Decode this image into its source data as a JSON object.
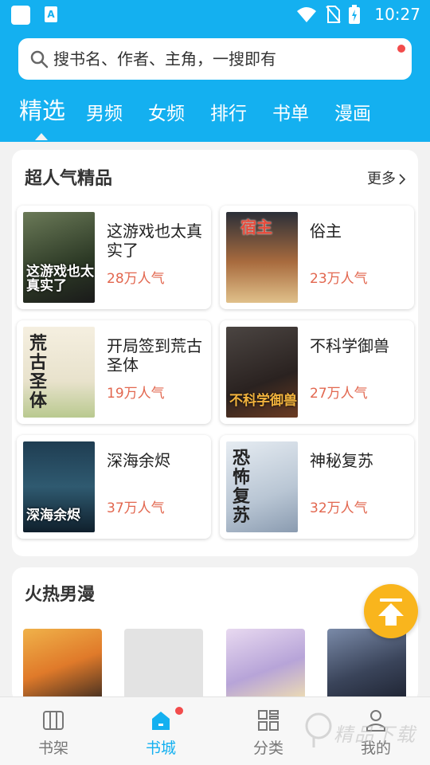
{
  "status_bar": {
    "time": "10:27",
    "notif_icon_letter": "A"
  },
  "search": {
    "placeholder": "搜书名、作者、主角，一搜即有"
  },
  "tabs": [
    {
      "label": "精选",
      "active": true
    },
    {
      "label": "男频"
    },
    {
      "label": "女频"
    },
    {
      "label": "排行"
    },
    {
      "label": "书单"
    },
    {
      "label": "漫画"
    }
  ],
  "section_popular": {
    "title": "超人气精品",
    "more_label": "更多",
    "books": [
      {
        "title": "这游戏也太真实了",
        "popularity": "28万人气",
        "cover_text": "这游戏也太真实了",
        "cover_color": "#4a5a3c"
      },
      {
        "title": "俗主",
        "popularity": "23万人气",
        "cover_text": "宿主",
        "cover_color": "#a86b3e"
      },
      {
        "title": "开局签到荒古圣体",
        "popularity": "19万人气",
        "cover_text": "荒古圣体",
        "cover_color": "#f2ead8"
      },
      {
        "title": "不科学御兽",
        "popularity": "27万人气",
        "cover_text": "不科学御兽",
        "cover_color": "#3a2f2c"
      },
      {
        "title": "深海余烬",
        "popularity": "37万人气",
        "cover_text": "深海余烬",
        "cover_color": "#27465a"
      },
      {
        "title": "神秘复苏",
        "popularity": "32万人气",
        "cover_text": "恐怖复苏",
        "cover_color": "#c9d3df"
      }
    ]
  },
  "section_comics": {
    "title": "火热男漫",
    "comics": [
      {
        "color": "#e59a3b"
      },
      {
        "color": "#e3e3e3"
      },
      {
        "color": "#c7b7dd"
      },
      {
        "color": "#4a556a"
      }
    ]
  },
  "bottom_nav": [
    {
      "label": "书架",
      "icon": "bookshelf-icon"
    },
    {
      "label": "书城",
      "icon": "bookstore-icon",
      "active": true
    },
    {
      "label": "分类",
      "icon": "category-icon"
    },
    {
      "label": "我的",
      "icon": "profile-icon"
    }
  ],
  "watermark": {
    "text": "精品下载"
  },
  "colors": {
    "brand": "#14b0f0",
    "popularity": "#e2674f",
    "fab": "#f9b51d",
    "badge": "#f24c4c"
  }
}
